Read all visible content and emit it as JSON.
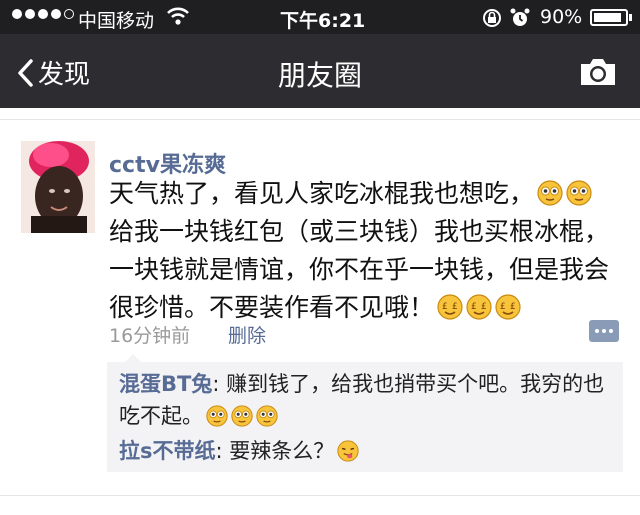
{
  "status_bar": {
    "carrier": "中国移动",
    "time": "下午6:21",
    "battery_percent_label": "90%",
    "battery_level": 0.9,
    "signal_bars_filled": 4,
    "signal_bars_total": 5
  },
  "nav": {
    "back_label": "发现",
    "title": "朋友圈",
    "right_icon": "camera-icon"
  },
  "post": {
    "author": "cctv果冻爽",
    "lines": [
      "天气热了，看见人家吃冰棍我也想吃，",
      "给我一块钱红包（或三块钱）我也买根冰棍，",
      "一块钱就是情谊，你不在乎一块钱，但是我会",
      "很珍惜。不要装作看不见哦！"
    ],
    "time_ago": "16分钟前",
    "delete_label": "删除",
    "comments": [
      {
        "name": "混蛋BT兔",
        "separator": ": ",
        "text": "赚到钱了，给我也捎带买个吧。我穷的也吃不起。"
      },
      {
        "name": "拉s不带纸",
        "separator": ": ",
        "text": "要辣条么？"
      }
    ]
  },
  "colors": {
    "statusbar_bg": "#1f1f22",
    "navbar_bg": "#2d2d31",
    "link_blue": "#576b95",
    "comment_bg": "#f3f3f5"
  }
}
